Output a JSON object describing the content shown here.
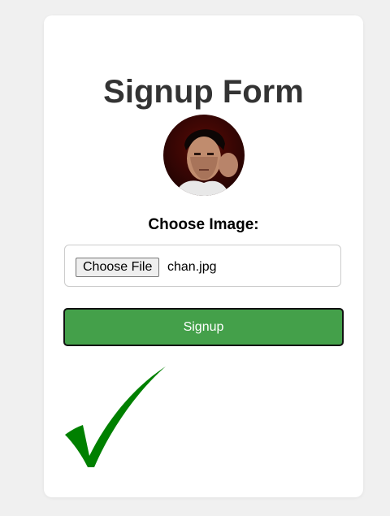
{
  "form": {
    "title": "Signup Form",
    "choose_image_label": "Choose Image:",
    "file_button_label": "Choose File",
    "file_name": "chan.jpg",
    "submit_label": "Signup"
  },
  "status": {
    "success_icon": "check-mark-icon",
    "success_color": "#008000"
  },
  "colors": {
    "page_background": "#f0f0f0",
    "card_background": "#ffffff",
    "submit_background": "#44a04a",
    "title_color": "#333333"
  }
}
